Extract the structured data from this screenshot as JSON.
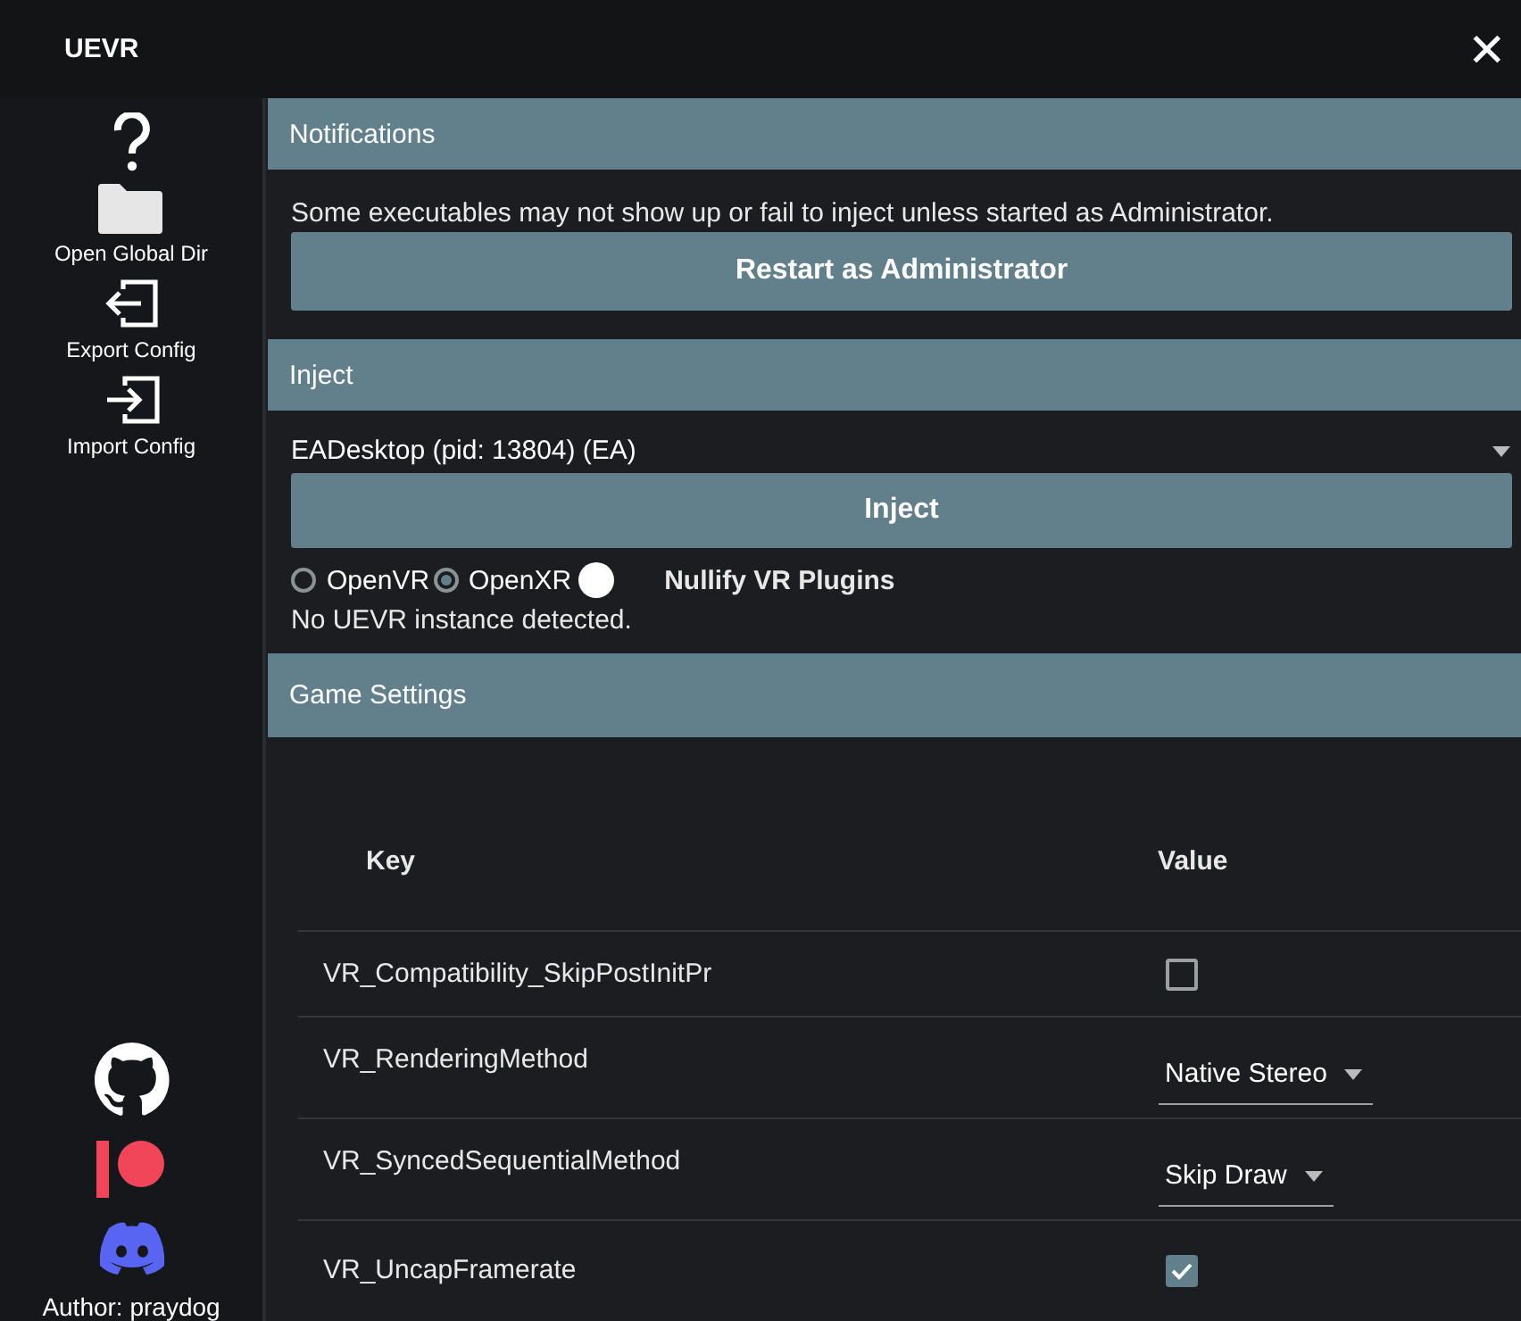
{
  "app": {
    "title": "UEVR",
    "close": "✕"
  },
  "sidebar": {
    "items": [
      {
        "kind": "help"
      },
      {
        "kind": "folder",
        "label": "Open Global Dir"
      },
      {
        "kind": "export",
        "label": "Export Config"
      },
      {
        "kind": "import",
        "label": "Import Config"
      }
    ],
    "links": [
      {
        "kind": "github"
      },
      {
        "kind": "patreon"
      },
      {
        "kind": "discord"
      }
    ],
    "author": "Author: praydog"
  },
  "notifications": {
    "title": "Notifications",
    "message": "Some executables may not show up or fail to inject unless started as Administrator.",
    "button": "Restart as Administrator"
  },
  "inject": {
    "title": "Inject",
    "process": "EADesktop (pid: 13804) (EA)",
    "button": "Inject",
    "runtimes": [
      {
        "label": "OpenVR",
        "selected": false
      },
      {
        "label": "OpenXR",
        "selected": true
      }
    ],
    "nullify": {
      "label": "Nullify VR Plugins",
      "on": false
    },
    "status": "No UEVR instance detected."
  },
  "game_settings": {
    "title": "Game Settings",
    "columns": [
      "Key",
      "Value"
    ],
    "rows": [
      {
        "key": "VR_Compatibility_SkipPostInitPr",
        "kind": "checkbox",
        "checked": false
      },
      {
        "key": "VR_RenderingMethod",
        "kind": "combo",
        "value": "Native Stereo"
      },
      {
        "key": "VR_SyncedSequentialMethod",
        "kind": "combo",
        "value": "Skip Draw"
      },
      {
        "key": "VR_UncapFramerate",
        "kind": "checkbox",
        "checked": true
      }
    ]
  }
}
